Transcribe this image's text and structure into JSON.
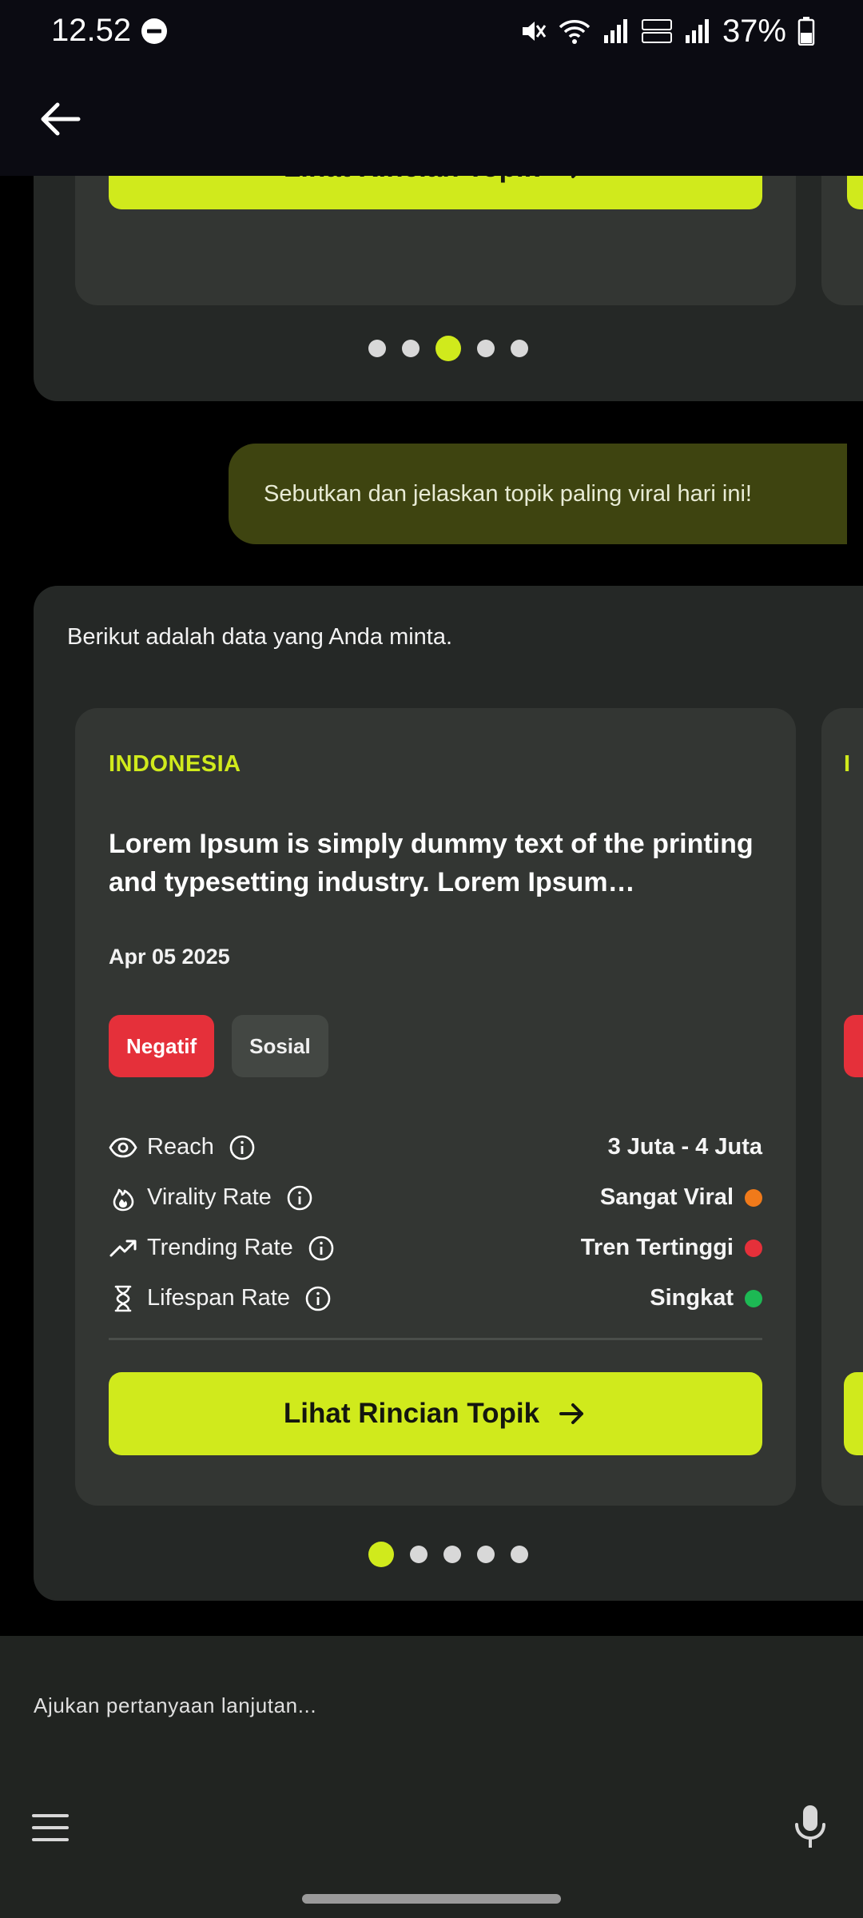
{
  "status_bar": {
    "time": "12.52",
    "battery": "37%"
  },
  "colors": {
    "accent": "#d0ea1c",
    "negative": "#e5303a",
    "viral": "#f07a1a",
    "trending": "#e5303a",
    "lifespan": "#1db954"
  },
  "icons": [
    "back-arrow-icon",
    "do-not-disturb-icon",
    "mute-icon",
    "wifi-icon",
    "signal-icon",
    "battery-icon",
    "eye-icon",
    "fire-icon",
    "trending-up-icon",
    "hourglass-icon",
    "info-icon",
    "arrow-right-icon",
    "menu-icon",
    "microphone-icon"
  ],
  "top_card": {
    "cta_label": "Lihat Rincian Topik",
    "dots": {
      "count": 5,
      "active_index": 2
    }
  },
  "user_message": "Sebutkan dan jelaskan topik paling viral hari ini!",
  "response": {
    "intro": "Berikut adalah data yang Anda minta.",
    "topic": {
      "country": "INDONESIA",
      "headline": "Lorem Ipsum is simply dummy text of the printing and typesetting industry. Lorem Ipsum…",
      "date": "Apr 05 2025",
      "tags": {
        "sentiment": "Negatif",
        "category": "Sosial"
      },
      "metrics": {
        "reach": {
          "label": "Reach",
          "value": "3 Juta - 4 Juta"
        },
        "virality": {
          "label": "Virality Rate",
          "value": "Sangat Viral"
        },
        "trending": {
          "label": "Trending Rate",
          "value": "Tren Tertinggi"
        },
        "lifespan": {
          "label": "Lifespan Rate",
          "value": "Singkat"
        }
      },
      "cta_label": "Lihat Rincian Topik"
    },
    "dots": {
      "count": 5,
      "active_index": 0
    }
  },
  "composer": {
    "placeholder": "Ajukan pertanyaan lanjutan..."
  }
}
